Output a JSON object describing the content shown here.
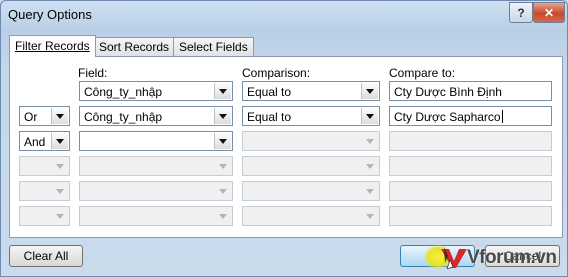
{
  "window": {
    "title": "Query Options",
    "help_label": "?",
    "close_label": "✕"
  },
  "tabs": [
    {
      "label": "Filter Records"
    },
    {
      "label": "Sort Records"
    },
    {
      "label": "Select Fields"
    }
  ],
  "headers": {
    "field": "Field:",
    "comparison": "Comparison:",
    "compare_to": "Compare to:"
  },
  "rows": [
    {
      "connector": "",
      "field": "Công_ty_nhập",
      "comparison": "Equal to",
      "compare_to": "Cty Dược Bình Định"
    },
    {
      "connector": "Or",
      "field": "Công_ty_nhập",
      "comparison": "Equal to",
      "compare_to": "Cty Dược Sapharco"
    },
    {
      "connector": "And",
      "field": "",
      "comparison": "",
      "compare_to": ""
    },
    {
      "connector": "",
      "field": "",
      "comparison": "",
      "compare_to": ""
    },
    {
      "connector": "",
      "field": "",
      "comparison": "",
      "compare_to": ""
    },
    {
      "connector": "",
      "field": "",
      "comparison": "",
      "compare_to": ""
    }
  ],
  "buttons": {
    "clear_all": "Clear All",
    "ok": "OK",
    "cancel": "Cancel"
  },
  "watermark": {
    "text": "Vforum.vn"
  },
  "colors": {
    "close_button": "#c8492c",
    "default_button_border": "#3c7fb1",
    "watermark_red": "#d8262e"
  }
}
